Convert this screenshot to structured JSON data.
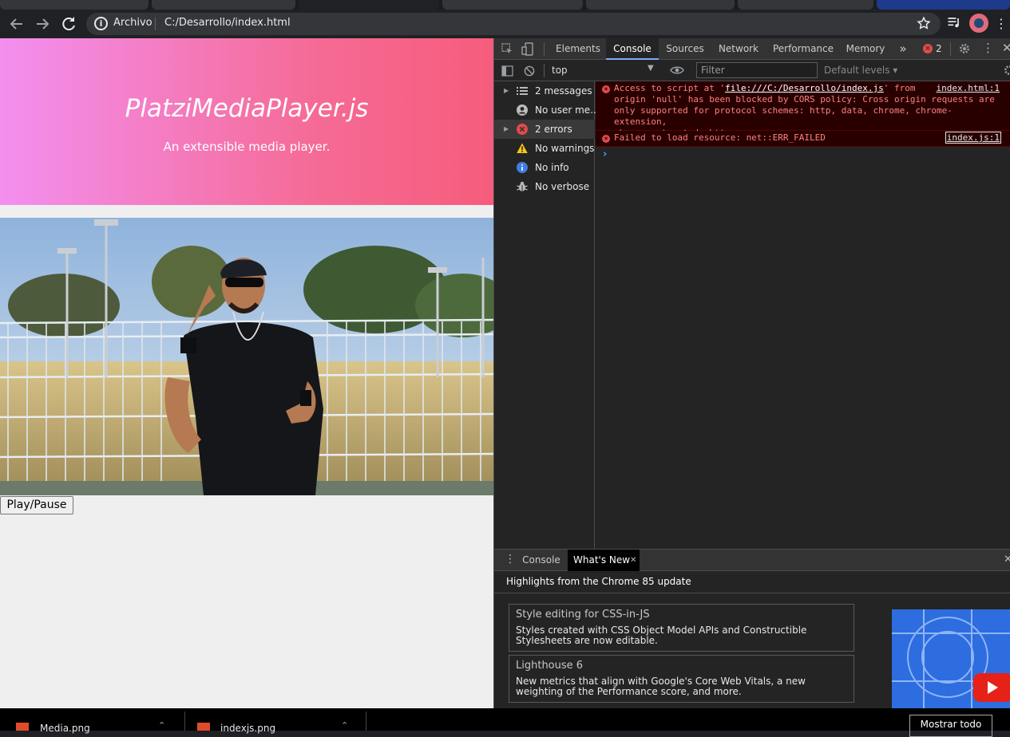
{
  "browser": {
    "omnibox": {
      "security_label": "Archivo",
      "url": "C:/Desarrollo/index.html"
    }
  },
  "page": {
    "title": "PlatziMediaPlayer.js",
    "subtitle": "An extensible media player.",
    "play_button": "Play/Pause"
  },
  "devtools": {
    "tabs": [
      "Elements",
      "Console",
      "Sources",
      "Network",
      "Performance",
      "Memory"
    ],
    "active_tab": "Console",
    "more_tabs": "»",
    "error_count": "2",
    "context": "top",
    "filter_placeholder": "Filter",
    "levels": "Default levels",
    "sidebar": [
      {
        "label": "2 messages",
        "icon": "list-icon"
      },
      {
        "label": "No user me...",
        "icon": "user-icon"
      },
      {
        "label": "2 errors",
        "icon": "error-icon"
      },
      {
        "label": "No warnings",
        "icon": "warning-icon"
      },
      {
        "label": "No info",
        "icon": "info-icon"
      },
      {
        "label": "No verbose",
        "icon": "bug-icon"
      }
    ],
    "messages": [
      {
        "prefix": "Access to script at '",
        "link": "file:///C:/Desarrollo/index.js",
        "suffix": "' from\norigin 'null' has been blocked by CORS policy: Cross origin requests are\nonly supported for protocol schemes: http, data, chrome, chrome-extension,\nchrome-untrusted, https.",
        "source": "index.html:1"
      },
      {
        "prefix": "Failed to load resource: net::ERR_FAILED",
        "link": "",
        "suffix": "",
        "source": "index.js:1"
      }
    ],
    "drawer": {
      "tabs": [
        "Console",
        "What's New"
      ],
      "heading": "Highlights from the Chrome 85 update",
      "cards": [
        {
          "title": "Style editing for CSS-in-JS",
          "desc": "Styles created with CSS Object Model APIs and Constructible Stylesheets are now editable."
        },
        {
          "title": "Lighthouse 6",
          "desc": "New metrics that align with Google's Core Web Vitals, a new weighting of the Performance score, and more."
        }
      ]
    }
  },
  "taskbar": {
    "items": [
      "Media.png",
      "indexjs.png"
    ],
    "show_all": "Mostrar todo"
  },
  "colors": {
    "hero_start": "#f38ff0",
    "hero_end": "#f65c7c",
    "error": "#e34a4a",
    "devtools_bg": "#242424"
  }
}
